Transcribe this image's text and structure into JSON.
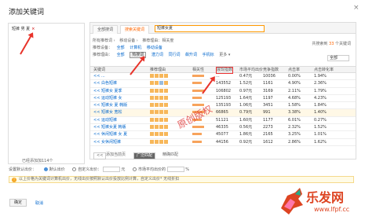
{
  "dialog": {
    "title": "添加关键词",
    "close": "×"
  },
  "left": {
    "keyword": "短裤 男 夏",
    "remove": "×",
    "footer": "已经添加加114个"
  },
  "tabs": [
    {
      "label": "全部搜词",
      "active": false
    },
    {
      "label": "搜索关键词",
      "active": true
    }
  ],
  "search": {
    "value": "短裤女夏"
  },
  "count": {
    "prefix": "共搜索到",
    "value": "33",
    "suffix": "个关键词"
  },
  "filters": {
    "row1": {
      "label": "所有推荐词 ›",
      "opts": [
        "移动设备 ›",
        "推荐理由：相关度"
      ]
    },
    "row2": {
      "label": "推荐设备：",
      "opts": [
        "全部",
        "计算机",
        "移动设备"
      ]
    },
    "row3": {
      "label": "推荐理由：",
      "opts": [
        "全部",
        "热搜词",
        "潜力词",
        "同行词",
        "飙升词",
        "手机标"
      ]
    },
    "more": "更多 ▾",
    "selall": "全部"
  },
  "table": {
    "headers": [
      "关键词",
      "推荐理由",
      "相关性",
      "展现指数",
      "市场平均出价",
      "竞争指数",
      "点击率",
      "点击转化率"
    ],
    "rows": [
      {
        "kw": "<<  ...",
        "score": 5,
        "clk": "...",
        "cpc": "0.47元",
        "cmp": "10036",
        "ctr": "0.00%",
        "cvr": "1.94%"
      },
      {
        "kw": "<< 白色短裤",
        "score": 4,
        "clk": "143552",
        "cpc": "1.52元",
        "cmp": "1161",
        "ctr": "4.90%",
        "cvr": "2.36%"
      },
      {
        "kw": "<< 短裤女 夏季",
        "score": 5,
        "clk": "106802",
        "cpc": "0.97元",
        "cmp": "3169",
        "ctr": "2.11%",
        "cvr": "1.79%"
      },
      {
        "kw": "<< 运动短裤 女",
        "score": 4,
        "clk": "125193",
        "cpc": "1.64元",
        "cmp": "1197",
        "ctr": "4.68%",
        "cvr": "4.23%"
      },
      {
        "kw": "<< 短裤女 夏 韩版",
        "score": 5,
        "clk": "135193",
        "cpc": "1.06元",
        "cmp": "3451",
        "ctr": "1.58%",
        "cvr": "1.84%"
      },
      {
        "kw": "<< 短裤女 宽松",
        "score": 5,
        "clk": "66865",
        "cpc": "0.79元",
        "cmp": "991",
        "ctr": "3.38%",
        "cvr": "1.40%"
      },
      {
        "kw": "<< 运动短裤",
        "score": 4,
        "clk": "51121",
        "cpc": "1.60元",
        "cmp": "1177",
        "ctr": "6.01%",
        "cvr": "0.27%"
      },
      {
        "kw": "<< 短裤女夏 韩版",
        "score": 5,
        "clk": "46335",
        "cpc": "0.56元",
        "cmp": "2273",
        "ctr": "2.32%",
        "cvr": "1.52%"
      },
      {
        "kw": "<< 休闲短裤 女 夏",
        "score": 4,
        "clk": "45077",
        "cpc": "1.86元",
        "cmp": "2165",
        "ctr": "3.25%",
        "cvr": "1.01%"
      },
      {
        "kw": "<< 女休闲短裤",
        "score": 4,
        "clk": "44156",
        "cpc": "0.92元",
        "cmp": "1612",
        "ctr": "2.86%",
        "cvr": "1.62%"
      }
    ]
  },
  "pager": {
    "prev": "<<",
    "text": "添加当前页",
    "cur": "广泛匹配",
    "mode": "精确匹配"
  },
  "bid": {
    "label": "设置默认出价：",
    "opt1": "默认出价",
    "opt2": "自定义出价：",
    "opt3": "市场平均出价的",
    "unit": "元",
    "pct": "%"
  },
  "note": {
    "icon": "!",
    "text": "以上价格为关键词计算机出价，无线出价按照默认出价投放比例计算，自定义出价* 无线折扣"
  },
  "buttons": {
    "ok": "确定",
    "cancel": "取消"
  },
  "watermark": "原创版权",
  "logo": {
    "name": "乐发网",
    "url": "www.lfpf.cc"
  }
}
